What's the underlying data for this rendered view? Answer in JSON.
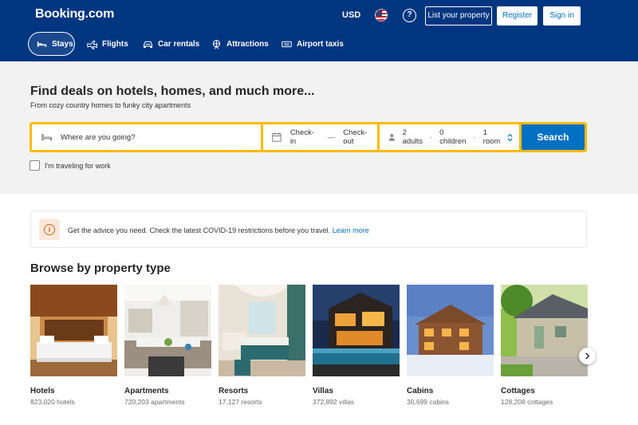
{
  "header": {
    "logo": "Booking.com",
    "currency": "USD",
    "help": "?",
    "list_property": "List your property",
    "register": "Register",
    "sign_in": "Sign in"
  },
  "nav": {
    "stays": "Stays",
    "flights": "Flights",
    "car_rentals": "Car rentals",
    "attractions": "Attractions",
    "airport_taxis": "Airport taxis"
  },
  "hero": {
    "title": "Find deals on hotels, homes, and much more...",
    "subtitle": "From cozy country homes to funky city apartments"
  },
  "search": {
    "destination_placeholder": "Where are you going?",
    "check_in": "Check-in",
    "check_out": "Check-out",
    "dash": "—",
    "adults": "2 adults",
    "children": "0 children",
    "rooms": "1 room",
    "dot": "·",
    "button": "Search",
    "work_travel": "I'm traveling for work"
  },
  "notice": {
    "text": "Get the advice you need. Check the latest COVID-19 restrictions before you travel.",
    "link": "Learn more"
  },
  "browse": {
    "title": "Browse by property type",
    "items": [
      {
        "name": "Hotels",
        "count": "823,020 hotels"
      },
      {
        "name": "Apartments",
        "count": "720,203 apartments"
      },
      {
        "name": "Resorts",
        "count": "17,127 resorts"
      },
      {
        "name": "Villas",
        "count": "372,892 villas"
      },
      {
        "name": "Cabins",
        "count": "30,699 cabins"
      },
      {
        "name": "Cottages",
        "count": "128,208 cottages"
      }
    ]
  },
  "colors": {
    "brand_blue": "#003580",
    "action_blue": "#0071c2",
    "search_yellow": "#febb02"
  }
}
